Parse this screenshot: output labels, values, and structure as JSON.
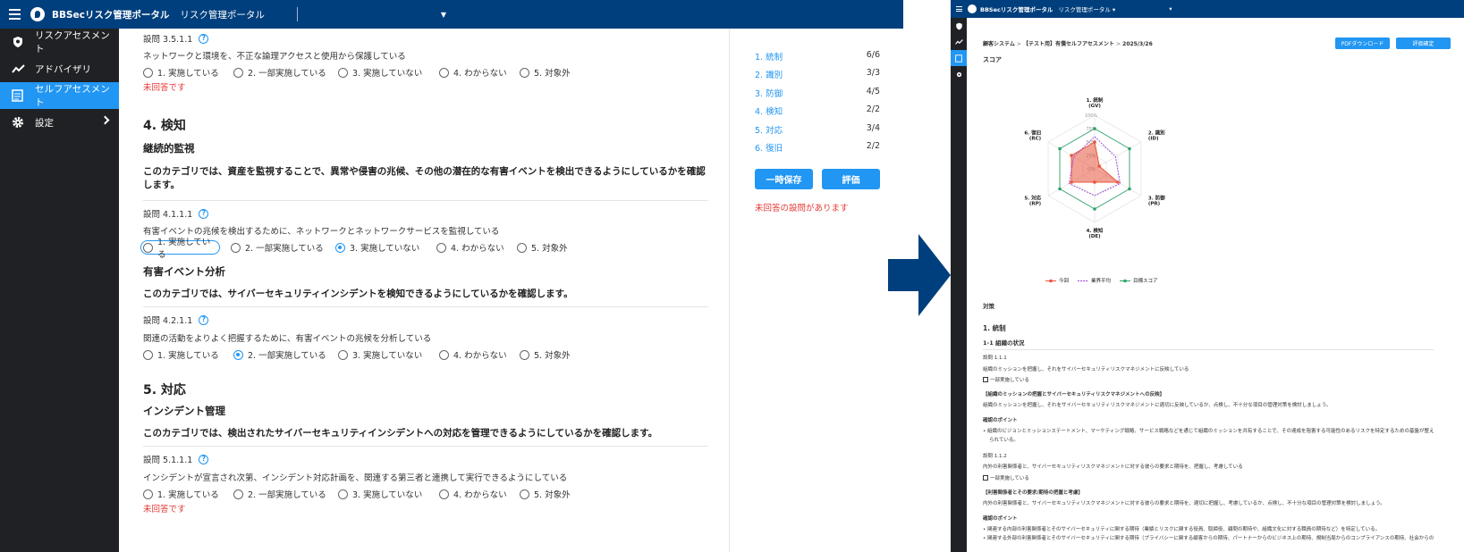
{
  "left": {
    "topbar": {
      "brand": "BBSecリスク管理ポータル",
      "title": "リスク管理ポータル"
    },
    "sidebar": {
      "items": [
        {
          "label": "リスクアセスメント",
          "icon": "shield-search-icon"
        },
        {
          "label": "アドバイザリ",
          "icon": "trend-icon"
        },
        {
          "label": "セルフアセスメント",
          "icon": "list-icon",
          "active": true
        },
        {
          "label": "設定",
          "icon": "gear-icon"
        }
      ]
    },
    "options": [
      "1. 実施している",
      "2. 一部実施している",
      "3. 実施していない",
      "4. わからない",
      "5. 対象外"
    ],
    "q351": {
      "num": "設問 3.5.1.1",
      "text": "ネットワークと環境を、不正な論理アクセスと使用から保護している",
      "unanswered": "未回答です"
    },
    "cat4": {
      "heading": "4. 検知",
      "sub1": "継続的監視",
      "desc1": "このカテゴリでは、資産を監視することで、異常や侵害の兆候、その他の潜在的な有害イベントを検出できるようにしているかを確認します。",
      "q411": {
        "num": "設問 4.1.1.1",
        "text": "有害イベントの兆候を検出するために、ネットワークとネットワークサービスを監視している"
      },
      "sub2": "有害イベント分析",
      "desc2": "このカテゴリでは、サイバーセキュリティインシデントを検知できるようにしているかを確認します。",
      "q421": {
        "num": "設問 4.2.1.1",
        "text": "関連の活動をよりよく把握するために、有害イベントの兆候を分析している"
      }
    },
    "cat5": {
      "heading": "5. 対応",
      "sub1": "インシデント管理",
      "desc1": "このカテゴリでは、検出されたサイバーセキュリティインシデントへの対応を管理できるようにしているかを確認します。",
      "q511": {
        "num": "設問 5.1.1.1",
        "text": "インシデントが宣言され次第、インシデント対応計画を、関連する第三者と連携して実行できるようにしている",
        "unanswered": "未回答です"
      }
    },
    "progress": [
      {
        "label": "1. 統制",
        "value": "6/6"
      },
      {
        "label": "2. 識別",
        "value": "3/3"
      },
      {
        "label": "3. 防御",
        "value": "4/5"
      },
      {
        "label": "4. 検知",
        "value": "2/2"
      },
      {
        "label": "5. 対応",
        "value": "3/4"
      },
      {
        "label": "6. 復旧",
        "value": "2/2"
      }
    ],
    "save_button": "一時保存",
    "eval_button": "評価",
    "warning": "未回答の設問があります"
  },
  "right": {
    "topbar": {
      "brand": "BBSecリスク管理ポータル",
      "title": "リスク管理ポータル ▾"
    },
    "breadcrumb": {
      "a": "顧客システム",
      "b": "【テスト用】有償セルフアセスメント",
      "c": "2025/3/26"
    },
    "pdf_button": "PDFダウンロード",
    "confirm_button": "評価確定",
    "score_title": "スコア",
    "measures_title": "対策",
    "sec1": "1. 統制",
    "sec11": "1-1 組織の状況",
    "q111": "設問 1.1.1",
    "q111_text": "組織のミッションを把握し、それをサイバーセキュリティリスクマネジメントに反映している",
    "q111_status": "一部実施している",
    "q111_head": "【組織のミッションの把握とサイバーセキュリティリスクマネジメントへの反映】",
    "q111_body": "組織のミッションを把握し、それをサイバーセキュリティリスクマネジメントに適切に反映しているか、点検し、不十分な項目の管理対策を検討しましょう。",
    "point1": "確認のポイント",
    "point1_text": "• 組織のビジョンとミッションステートメント、マーケティング戦略、サービス戦略などを通じて組織のミッションを共有することで、その達成を阻害する可能性のあるリスクを特定するための基盤が整え",
    "point1_text2": "られている。",
    "q112": "設問 1.1.2",
    "q112_text": "内外の利害関係者と、サイバーセキュリティリスクマネジメントに対する彼らの要求と期待を、把握し、考慮している",
    "q112_status": "一部実施している",
    "q112_head": "【利害関係者とその要求/期待の把握と考慮】",
    "q112_body": "内外の利害関係者と、サイバーセキュリティリスクマネジメントに対する彼らの要求と期待を、適切に把握し、考慮しているか、点検し、不十分な項目の管理対策を検討しましょう。",
    "point2": "確認のポイント",
    "point2_a": "• 関連する内部の利害関係者とそのサイバーセキュリティに関する期待（業績とリスクに関する役員、取締役、顧問の期待や、組織文化に対する職員の期待など）を特定している。",
    "point2_b": "• 関連する外部の利害関係者とそのサイバーセキュリティに関する期待（プライバシーに関する顧客からの期待、パートナーからのビジネス上の期待、規制当局からのコンプライアンスの期待、社会からの"
  },
  "chart_data": {
    "type": "radar",
    "categories": [
      "1. 統制 (GV)",
      "2. 識別 (ID)",
      "3. 防御 (PR)",
      "4. 検知 (DE)",
      "5. 対応 (RP)",
      "6. 復旧 (RC)"
    ],
    "axis_labels": [
      [
        "1. 統制",
        "(GV)"
      ],
      [
        "2. 識別",
        "(ID)"
      ],
      [
        "3. 防御",
        "(PR)"
      ],
      [
        "4. 検知",
        "(DE)"
      ],
      [
        "5. 対応",
        "(RP)"
      ],
      [
        "6. 復旧",
        "(RC)"
      ]
    ],
    "ticks": [
      "0%",
      "25%",
      "50%",
      "75%",
      "100%"
    ],
    "series": [
      {
        "name": "今回",
        "values": [
          50,
          10,
          50,
          25,
          50,
          50
        ],
        "color": "#e8553d"
      },
      {
        "name": "業界平均",
        "values": [
          60,
          45,
          55,
          50,
          55,
          45
        ],
        "color": "#9b3fd1"
      },
      {
        "name": "目標スコア",
        "values": [
          75,
          75,
          75,
          75,
          75,
          75
        ],
        "color": "#2ea36a"
      }
    ],
    "ylim": [
      0,
      100
    ]
  }
}
